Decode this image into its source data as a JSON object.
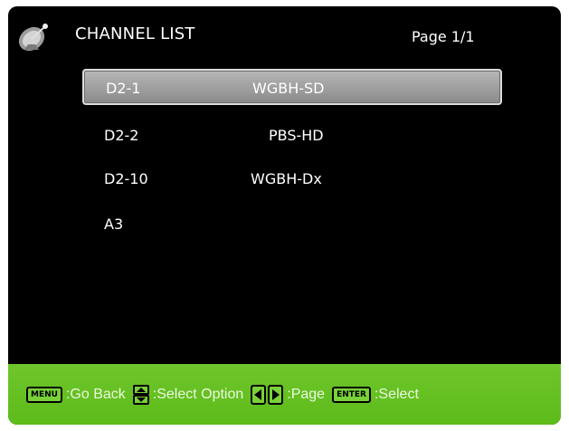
{
  "header": {
    "title": "CHANNEL LIST",
    "page": "Page 1/1",
    "logo_icon": "satellite-dish-icon"
  },
  "channels": [
    {
      "number": "D2-1",
      "name": "WGBH-SD",
      "selected": true
    },
    {
      "number": "D2-2",
      "name": "PBS-HD",
      "selected": false
    },
    {
      "number": "D2-10",
      "name": "WGBH-Dx",
      "selected": false
    },
    {
      "number": "A3",
      "name": "",
      "selected": false
    }
  ],
  "footer": {
    "menu_key": "MENU",
    "menu_label": ":Go Back",
    "updown_icon": "up-down-arrow-icon",
    "updown_label": ":Select Option",
    "leftright_icon": "left-right-arrow-icon",
    "leftright_label": ":Page",
    "enter_key": "ENTER",
    "enter_label": ":Select"
  },
  "colors": {
    "background": "#000000",
    "footer": "#65c21f",
    "highlight": "#a4a4a4",
    "text": "#ffffff"
  }
}
